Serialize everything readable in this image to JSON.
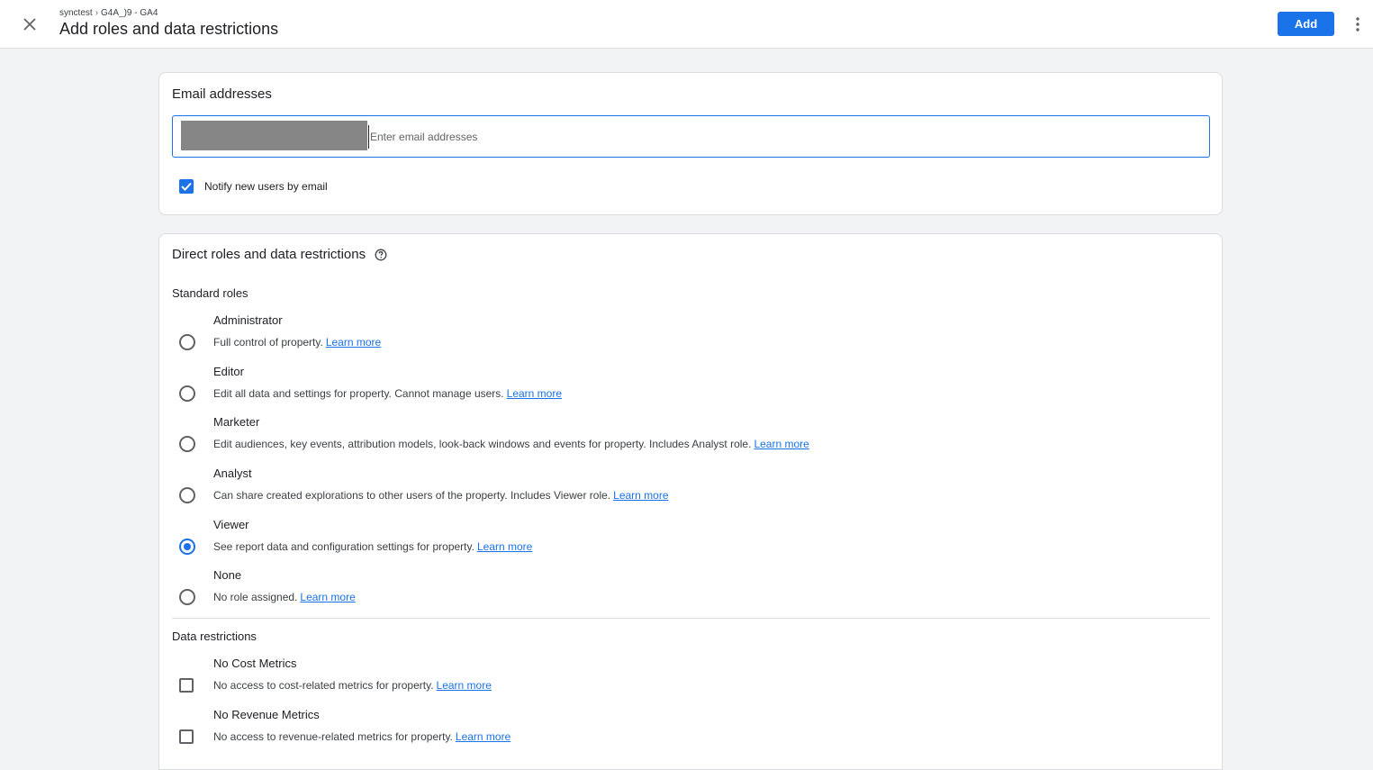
{
  "header": {
    "breadcrumb_account": "synctest",
    "breadcrumb_separator": "›",
    "breadcrumb_property": "G4A_)9 - GA4",
    "title": "Add roles and data restrictions",
    "add_label": "Add",
    "close_icon": "close-icon",
    "more_icon": "more-vert-icon"
  },
  "email": {
    "heading": "Email addresses",
    "placeholder": "Enter email addresses",
    "value": "",
    "notify_label": "Notify new users by email",
    "notify_checked": true
  },
  "roles": {
    "heading": "Direct roles and data restrictions",
    "standard_heading": "Standard roles",
    "selected": "Viewer",
    "options": [
      {
        "title": "Administrator",
        "desc": "Full control of property.",
        "link": "Learn more"
      },
      {
        "title": "Editor",
        "desc": "Edit all data and settings for property. Cannot manage users.",
        "link": "Learn more"
      },
      {
        "title": "Marketer",
        "desc": "Edit audiences, key events, attribution models, look-back windows and events for property. Includes Analyst role.",
        "link": "Learn more"
      },
      {
        "title": "Analyst",
        "desc": "Can share created explorations to other users of the property. Includes Viewer role.",
        "link": "Learn more"
      },
      {
        "title": "Viewer",
        "desc": "See report data and configuration settings for property.",
        "link": "Learn more"
      },
      {
        "title": "None",
        "desc": "No role assigned.",
        "link": "Learn more"
      }
    ]
  },
  "restrictions": {
    "heading": "Data restrictions",
    "options": [
      {
        "title": "No Cost Metrics",
        "desc": "No access to cost-related metrics for property.",
        "link": "Learn more",
        "checked": false
      },
      {
        "title": "No Revenue Metrics",
        "desc": "No access to revenue-related metrics for property.",
        "link": "Learn more",
        "checked": false
      }
    ]
  },
  "colors": {
    "accent": "#1a73e8",
    "background": "#f1f3f4",
    "card": "#ffffff",
    "redacted": "#868686"
  }
}
